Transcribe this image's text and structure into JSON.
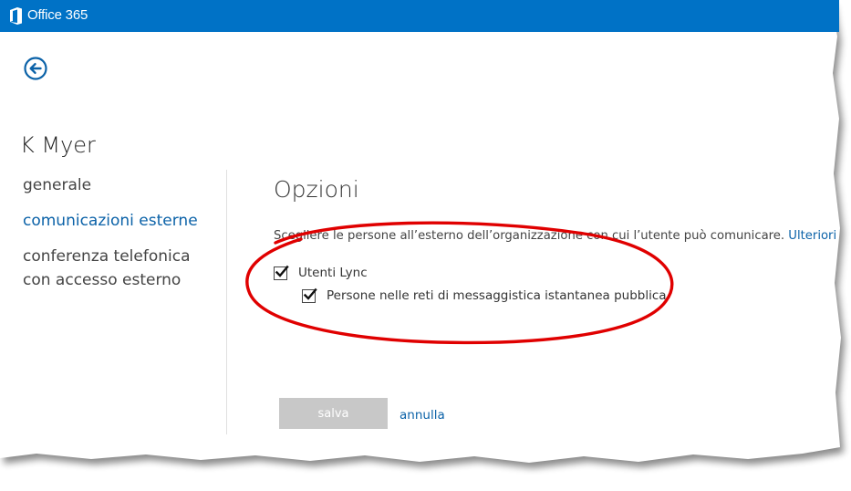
{
  "header": {
    "brand": "Office 365",
    "accent_color": "#0072c6"
  },
  "user": {
    "name": "K Myer"
  },
  "nav": {
    "items": [
      {
        "label": "generale",
        "active": false
      },
      {
        "label": "comunicazioni esterne",
        "active": true
      },
      {
        "label_lines": [
          "conferenza telefonica",
          "con accesso esterno"
        ],
        "active": false
      }
    ]
  },
  "main": {
    "title": "Opzioni",
    "description": "Scegliere le persone all’esterno dell’organizzazione con cui l’utente può comunicare.",
    "more_link": "Ulteriori",
    "checkboxes": [
      {
        "label": "Utenti Lync",
        "checked": true
      },
      {
        "label": "Persone nelle reti di messaggistica istantanea pubblica",
        "checked": true
      }
    ],
    "save_label": "salva",
    "cancel_label": "annulla"
  },
  "icons": {
    "logo": "office-logo-icon",
    "back": "back-arrow-icon",
    "check": "checkmark-icon"
  },
  "annotation_color": "#e00000"
}
